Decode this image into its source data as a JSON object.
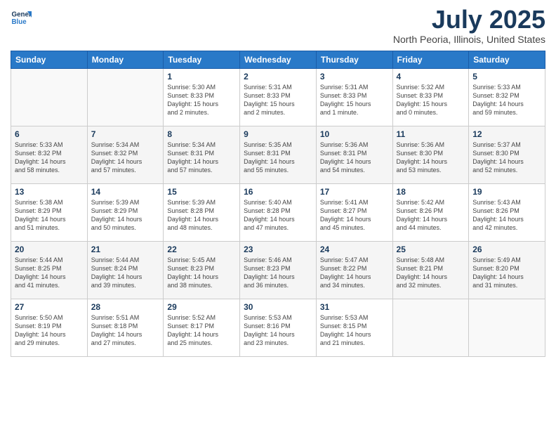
{
  "header": {
    "logo_line1": "General",
    "logo_line2": "Blue",
    "month": "July 2025",
    "location": "North Peoria, Illinois, United States"
  },
  "weekdays": [
    "Sunday",
    "Monday",
    "Tuesday",
    "Wednesday",
    "Thursday",
    "Friday",
    "Saturday"
  ],
  "weeks": [
    [
      {
        "day": "",
        "info": ""
      },
      {
        "day": "",
        "info": ""
      },
      {
        "day": "1",
        "info": "Sunrise: 5:30 AM\nSunset: 8:33 PM\nDaylight: 15 hours\nand 2 minutes."
      },
      {
        "day": "2",
        "info": "Sunrise: 5:31 AM\nSunset: 8:33 PM\nDaylight: 15 hours\nand 2 minutes."
      },
      {
        "day": "3",
        "info": "Sunrise: 5:31 AM\nSunset: 8:33 PM\nDaylight: 15 hours\nand 1 minute."
      },
      {
        "day": "4",
        "info": "Sunrise: 5:32 AM\nSunset: 8:33 PM\nDaylight: 15 hours\nand 0 minutes."
      },
      {
        "day": "5",
        "info": "Sunrise: 5:33 AM\nSunset: 8:32 PM\nDaylight: 14 hours\nand 59 minutes."
      }
    ],
    [
      {
        "day": "6",
        "info": "Sunrise: 5:33 AM\nSunset: 8:32 PM\nDaylight: 14 hours\nand 58 minutes."
      },
      {
        "day": "7",
        "info": "Sunrise: 5:34 AM\nSunset: 8:32 PM\nDaylight: 14 hours\nand 57 minutes."
      },
      {
        "day": "8",
        "info": "Sunrise: 5:34 AM\nSunset: 8:31 PM\nDaylight: 14 hours\nand 57 minutes."
      },
      {
        "day": "9",
        "info": "Sunrise: 5:35 AM\nSunset: 8:31 PM\nDaylight: 14 hours\nand 55 minutes."
      },
      {
        "day": "10",
        "info": "Sunrise: 5:36 AM\nSunset: 8:31 PM\nDaylight: 14 hours\nand 54 minutes."
      },
      {
        "day": "11",
        "info": "Sunrise: 5:36 AM\nSunset: 8:30 PM\nDaylight: 14 hours\nand 53 minutes."
      },
      {
        "day": "12",
        "info": "Sunrise: 5:37 AM\nSunset: 8:30 PM\nDaylight: 14 hours\nand 52 minutes."
      }
    ],
    [
      {
        "day": "13",
        "info": "Sunrise: 5:38 AM\nSunset: 8:29 PM\nDaylight: 14 hours\nand 51 minutes."
      },
      {
        "day": "14",
        "info": "Sunrise: 5:39 AM\nSunset: 8:29 PM\nDaylight: 14 hours\nand 50 minutes."
      },
      {
        "day": "15",
        "info": "Sunrise: 5:39 AM\nSunset: 8:28 PM\nDaylight: 14 hours\nand 48 minutes."
      },
      {
        "day": "16",
        "info": "Sunrise: 5:40 AM\nSunset: 8:28 PM\nDaylight: 14 hours\nand 47 minutes."
      },
      {
        "day": "17",
        "info": "Sunrise: 5:41 AM\nSunset: 8:27 PM\nDaylight: 14 hours\nand 45 minutes."
      },
      {
        "day": "18",
        "info": "Sunrise: 5:42 AM\nSunset: 8:26 PM\nDaylight: 14 hours\nand 44 minutes."
      },
      {
        "day": "19",
        "info": "Sunrise: 5:43 AM\nSunset: 8:26 PM\nDaylight: 14 hours\nand 42 minutes."
      }
    ],
    [
      {
        "day": "20",
        "info": "Sunrise: 5:44 AM\nSunset: 8:25 PM\nDaylight: 14 hours\nand 41 minutes."
      },
      {
        "day": "21",
        "info": "Sunrise: 5:44 AM\nSunset: 8:24 PM\nDaylight: 14 hours\nand 39 minutes."
      },
      {
        "day": "22",
        "info": "Sunrise: 5:45 AM\nSunset: 8:23 PM\nDaylight: 14 hours\nand 38 minutes."
      },
      {
        "day": "23",
        "info": "Sunrise: 5:46 AM\nSunset: 8:23 PM\nDaylight: 14 hours\nand 36 minutes."
      },
      {
        "day": "24",
        "info": "Sunrise: 5:47 AM\nSunset: 8:22 PM\nDaylight: 14 hours\nand 34 minutes."
      },
      {
        "day": "25",
        "info": "Sunrise: 5:48 AM\nSunset: 8:21 PM\nDaylight: 14 hours\nand 32 minutes."
      },
      {
        "day": "26",
        "info": "Sunrise: 5:49 AM\nSunset: 8:20 PM\nDaylight: 14 hours\nand 31 minutes."
      }
    ],
    [
      {
        "day": "27",
        "info": "Sunrise: 5:50 AM\nSunset: 8:19 PM\nDaylight: 14 hours\nand 29 minutes."
      },
      {
        "day": "28",
        "info": "Sunrise: 5:51 AM\nSunset: 8:18 PM\nDaylight: 14 hours\nand 27 minutes."
      },
      {
        "day": "29",
        "info": "Sunrise: 5:52 AM\nSunset: 8:17 PM\nDaylight: 14 hours\nand 25 minutes."
      },
      {
        "day": "30",
        "info": "Sunrise: 5:53 AM\nSunset: 8:16 PM\nDaylight: 14 hours\nand 23 minutes."
      },
      {
        "day": "31",
        "info": "Sunrise: 5:53 AM\nSunset: 8:15 PM\nDaylight: 14 hours\nand 21 minutes."
      },
      {
        "day": "",
        "info": ""
      },
      {
        "day": "",
        "info": ""
      }
    ]
  ]
}
